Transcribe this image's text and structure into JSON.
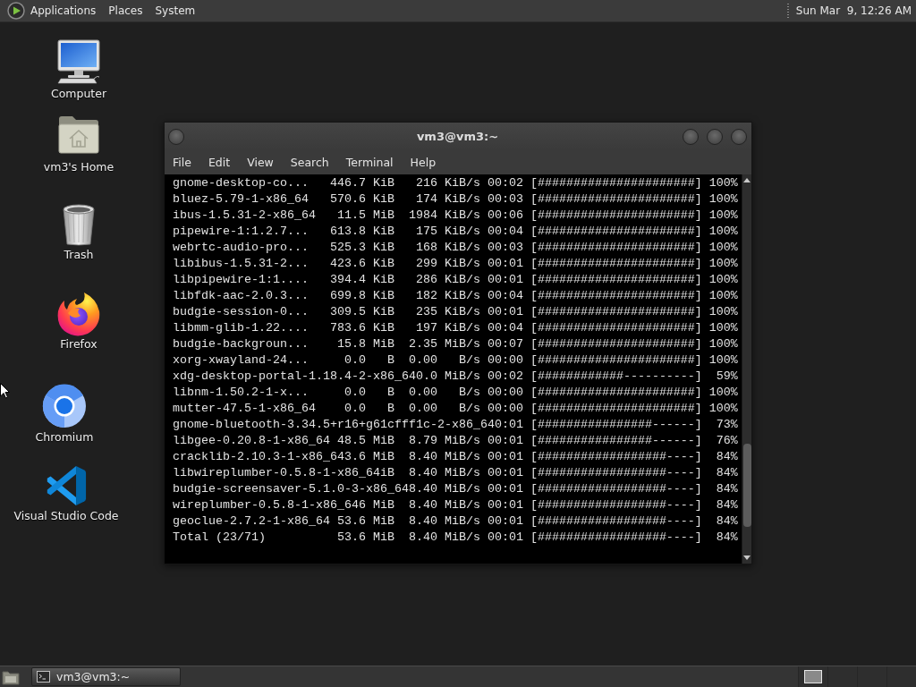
{
  "top_panel": {
    "menus": [
      "Applications",
      "Places",
      "System"
    ],
    "clock": "Sun Mar  9, 12:26 AM"
  },
  "desktop_icons": [
    {
      "label": "Computer",
      "kind": "computer"
    },
    {
      "label": "vm3's Home",
      "kind": "home"
    },
    {
      "label": "Trash",
      "kind": "trash"
    },
    {
      "label": "Firefox",
      "kind": "firefox"
    },
    {
      "label": "Chromium",
      "kind": "chromium"
    },
    {
      "label": "Visual Studio Code",
      "kind": "vscode"
    }
  ],
  "terminal_window": {
    "title": "vm3@vm3:~",
    "menu": [
      "File",
      "Edit",
      "View",
      "Search",
      "Terminal",
      "Help"
    ],
    "lines": [
      "gnome-desktop-co...   446.7 KiB   216 KiB/s 00:02 [######################] 100%",
      "bluez-5.79-1-x86_64   570.6 KiB   174 KiB/s 00:03 [######################] 100%",
      "ibus-1.5.31-2-x86_64   11.5 MiB  1984 KiB/s 00:06 [######################] 100%",
      "pipewire-1:1.2.7...   613.8 KiB   175 KiB/s 00:04 [######################] 100%",
      "webrtc-audio-pro...   525.3 KiB   168 KiB/s 00:03 [######################] 100%",
      "libibus-1.5.31-2...   423.6 KiB   299 KiB/s 00:01 [######################] 100%",
      "libpipewire-1:1....   394.4 KiB   286 KiB/s 00:01 [######################] 100%",
      "libfdk-aac-2.0.3...   699.8 KiB   182 KiB/s 00:04 [######################] 100%",
      "budgie-session-0...   309.5 KiB   235 KiB/s 00:01 [######################] 100%",
      "libmm-glib-1.22....   783.6 KiB   197 KiB/s 00:04 [######################] 100%",
      "budgie-backgroun...    15.8 MiB  2.35 MiB/s 00:07 [######################] 100%",
      "xorg-xwayland-24...     0.0   B  0.00   B/s 00:00 [######################] 100%",
      "xdg-desktop-portal-1.18.4-2-x86_640.0 MiB/s 00:02 [############----------]  59%",
      "libnm-1.50.2-1-x...     0.0   B  0.00   B/s 00:00 [######################] 100%",
      "mutter-47.5-1-x86_64    0.0   B  0.00   B/s 00:00 [######################] 100%",
      "gnome-bluetooth-3.34.5+r16+g61cfff1c-2-x86_640:01 [################------]  73%",
      "libgee-0.20.8-1-x86_64 48.5 MiB  8.79 MiB/s 00:01 [################------]  76%",
      "cracklib-2.10.3-1-x86_643.6 MiB  8.40 MiB/s 00:01 [##################----]  84%",
      "libwireplumber-0.5.8-1-x86_64iB  8.40 MiB/s 00:01 [##################----]  84%",
      "budgie-screensaver-5.1.0-3-x86_648.40 MiB/s 00:01 [##################----]  84%",
      "wireplumber-0.5.8-1-x86_646 MiB  8.40 MiB/s 00:01 [##################----]  84%",
      "geoclue-2.7.2-1-x86_64 53.6 MiB  8.40 MiB/s 00:01 [##################----]  84%",
      "Total (23/71)          53.6 MiB  8.40 MiB/s 00:01 [##################----]  84%"
    ]
  },
  "bottom_panel": {
    "tasks": [
      {
        "label": "vm3@vm3:~"
      }
    ],
    "workspaces": [
      {
        "selected": true
      },
      {
        "selected": false
      },
      {
        "selected": false
      },
      {
        "selected": false
      }
    ]
  }
}
